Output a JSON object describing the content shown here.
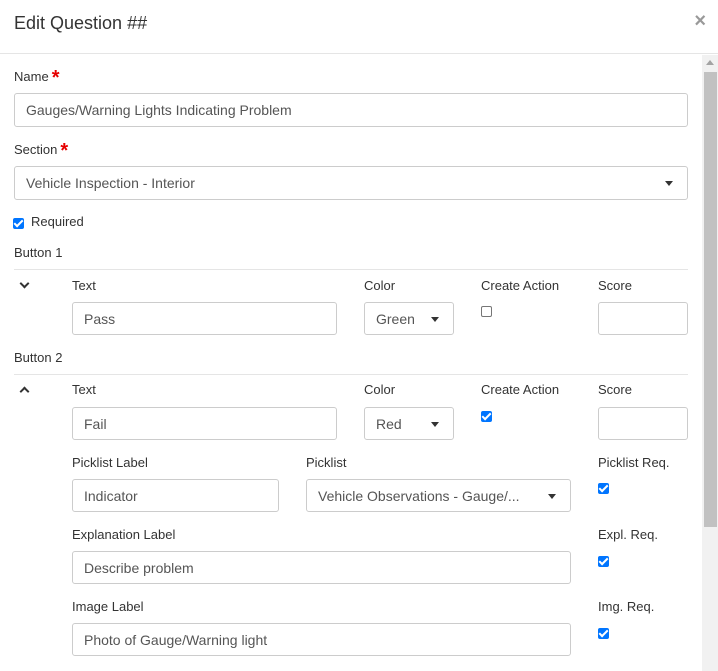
{
  "header": {
    "title": "Edit Question ##",
    "close_label": "×"
  },
  "name_field": {
    "label": "Name",
    "required_mark": "*",
    "value": "Gauges/Warning Lights Indicating Problem"
  },
  "section_field": {
    "label": "Section",
    "required_mark": "*",
    "value": "Vehicle Inspection - Interior"
  },
  "required_checkbox": {
    "label": "Required",
    "checked": true
  },
  "button1": {
    "heading": "Button 1",
    "text_label": "Text",
    "text_value": "Pass",
    "color_label": "Color",
    "color_value": "Green",
    "create_action_label": "Create Action",
    "create_action_checked": false,
    "score_label": "Score",
    "score_value": ""
  },
  "button2": {
    "heading": "Button 2",
    "text_label": "Text",
    "text_value": "Fail",
    "color_label": "Color",
    "color_value": "Red",
    "create_action_label": "Create Action",
    "create_action_checked": true,
    "score_label": "Score",
    "score_value": "",
    "picklist_label_label": "Picklist Label",
    "picklist_label_value": "Indicator",
    "picklist_label": "Picklist",
    "picklist_value": "Vehicle Observations - Gauge/...",
    "picklist_req_label": "Picklist Req.",
    "picklist_req_checked": true,
    "explanation_label_label": "Explanation Label",
    "explanation_label_value": "Describe problem",
    "expl_req_label": "Expl. Req.",
    "expl_req_checked": true,
    "image_label_label": "Image Label",
    "image_label_value": "Photo of Gauge/Warning light",
    "img_req_label": "Img. Req.",
    "img_req_checked": true
  },
  "colors": {
    "accent": "#0075ff",
    "required": "#e60000",
    "border": "#cccccc"
  }
}
